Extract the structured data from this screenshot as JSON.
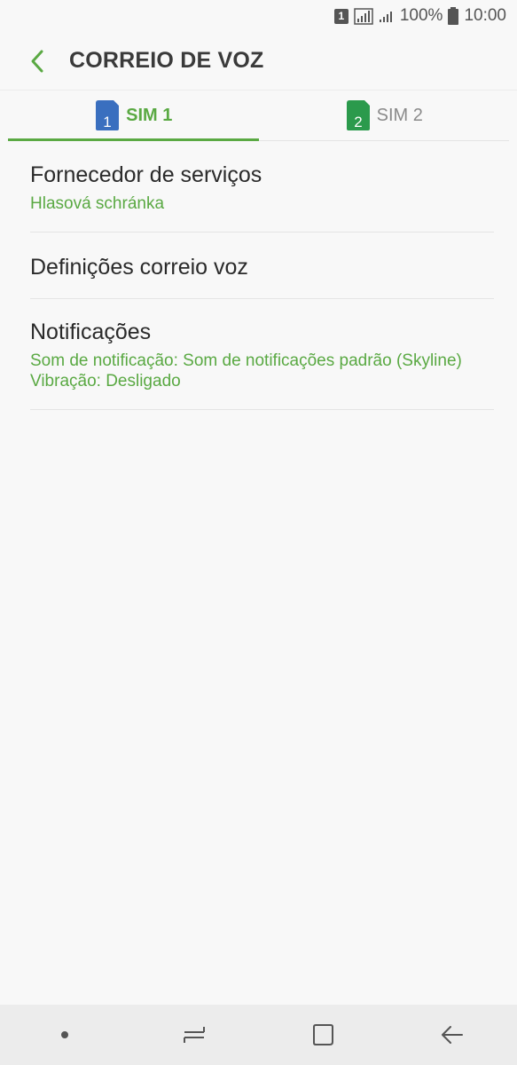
{
  "status_bar": {
    "sim_indicator": "1",
    "battery_percent": "100%",
    "time": "10:00",
    "icons": [
      "sim-1-icon",
      "signal-sim1-icon",
      "signal-sim2-icon",
      "battery-icon"
    ]
  },
  "header": {
    "back_icon": "chevron-left-icon",
    "title": "CORREIO DE VOZ"
  },
  "tabs": [
    {
      "label": "SIM 1",
      "number": "1",
      "active": true,
      "color": "#3a6fbf"
    },
    {
      "label": "SIM 2",
      "number": "2",
      "active": false,
      "color": "#2b9a4c"
    }
  ],
  "settings": {
    "service_provider": {
      "title": "Fornecedor de serviços",
      "value": "Hlasová schránka"
    },
    "voicemail_settings": {
      "title": "Definições correio voz"
    },
    "notifications": {
      "title": "Notificações",
      "sound": "Som de notificação: Som de notificações padrão (Skyline)",
      "vibration": "Vibração: Desligado"
    }
  },
  "nav_bar": {
    "icons": [
      "dot-icon",
      "recent-apps-icon",
      "home-icon",
      "back-arrow-icon"
    ]
  },
  "colors": {
    "accent": "#5aa943",
    "background": "#f8f8f8",
    "nav_background": "#ececec"
  }
}
